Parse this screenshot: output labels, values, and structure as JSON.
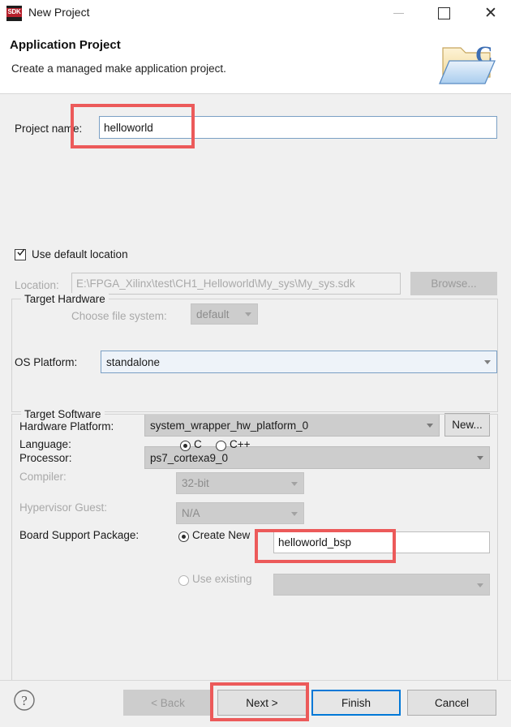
{
  "window": {
    "title": "New Project",
    "app_icon": "sdk-icon",
    "app_icon_text": "SDK",
    "minimize_label": "Minimize",
    "maximize_label": "Maximize",
    "close_label": "Close"
  },
  "banner": {
    "title": "Application Project",
    "subtitle": "Create a managed make application project.",
    "art_icon": "c-folder-icon"
  },
  "form": {
    "project_name_label": "Project name:",
    "project_name_value": "helloworld",
    "use_default_location_label": "Use default location",
    "use_default_location_checked": true,
    "location_label": "Location:",
    "location_value": "E:\\FPGA_Xilinx\\test\\CH1_Helloworld\\My_sys\\My_sys.sdk",
    "browse_label": "Browse...",
    "choose_fs_label": "Choose file system:",
    "choose_fs_value": "default",
    "os_platform_label": "OS Platform:",
    "os_platform_value": "standalone"
  },
  "target_hardware": {
    "group_title": "Target Hardware",
    "hardware_platform_label": "Hardware Platform:",
    "hardware_platform_value": "system_wrapper_hw_platform_0",
    "new_button_label": "New...",
    "processor_label": "Processor:",
    "processor_value": "ps7_cortexa9_0"
  },
  "target_software": {
    "group_title": "Target Software",
    "language_label": "Language:",
    "language_option_c": "C",
    "language_option_cpp": "C++",
    "language_selected": "C",
    "compiler_label": "Compiler:",
    "compiler_value": "32-bit",
    "hypervisor_label": "Hypervisor Guest:",
    "hypervisor_value": "N/A",
    "bsp_label": "Board Support Package:",
    "bsp_create_new_label": "Create New",
    "bsp_create_new_value": "helloworld_bsp",
    "bsp_use_existing_label": "Use existing",
    "bsp_use_existing_value": "",
    "bsp_selected": "Create New"
  },
  "footer": {
    "help_icon": "question-mark-icon",
    "back_label": "< Back",
    "next_label": "Next >",
    "finish_label": "Finish",
    "cancel_label": "Cancel",
    "back_enabled": false,
    "default_button": "Finish"
  },
  "annotations": {
    "accent_color": "#ec5a5a",
    "highlight_count": 3,
    "highlighted": [
      "project-name-field",
      "bsp-create-new-field",
      "next-button"
    ]
  }
}
